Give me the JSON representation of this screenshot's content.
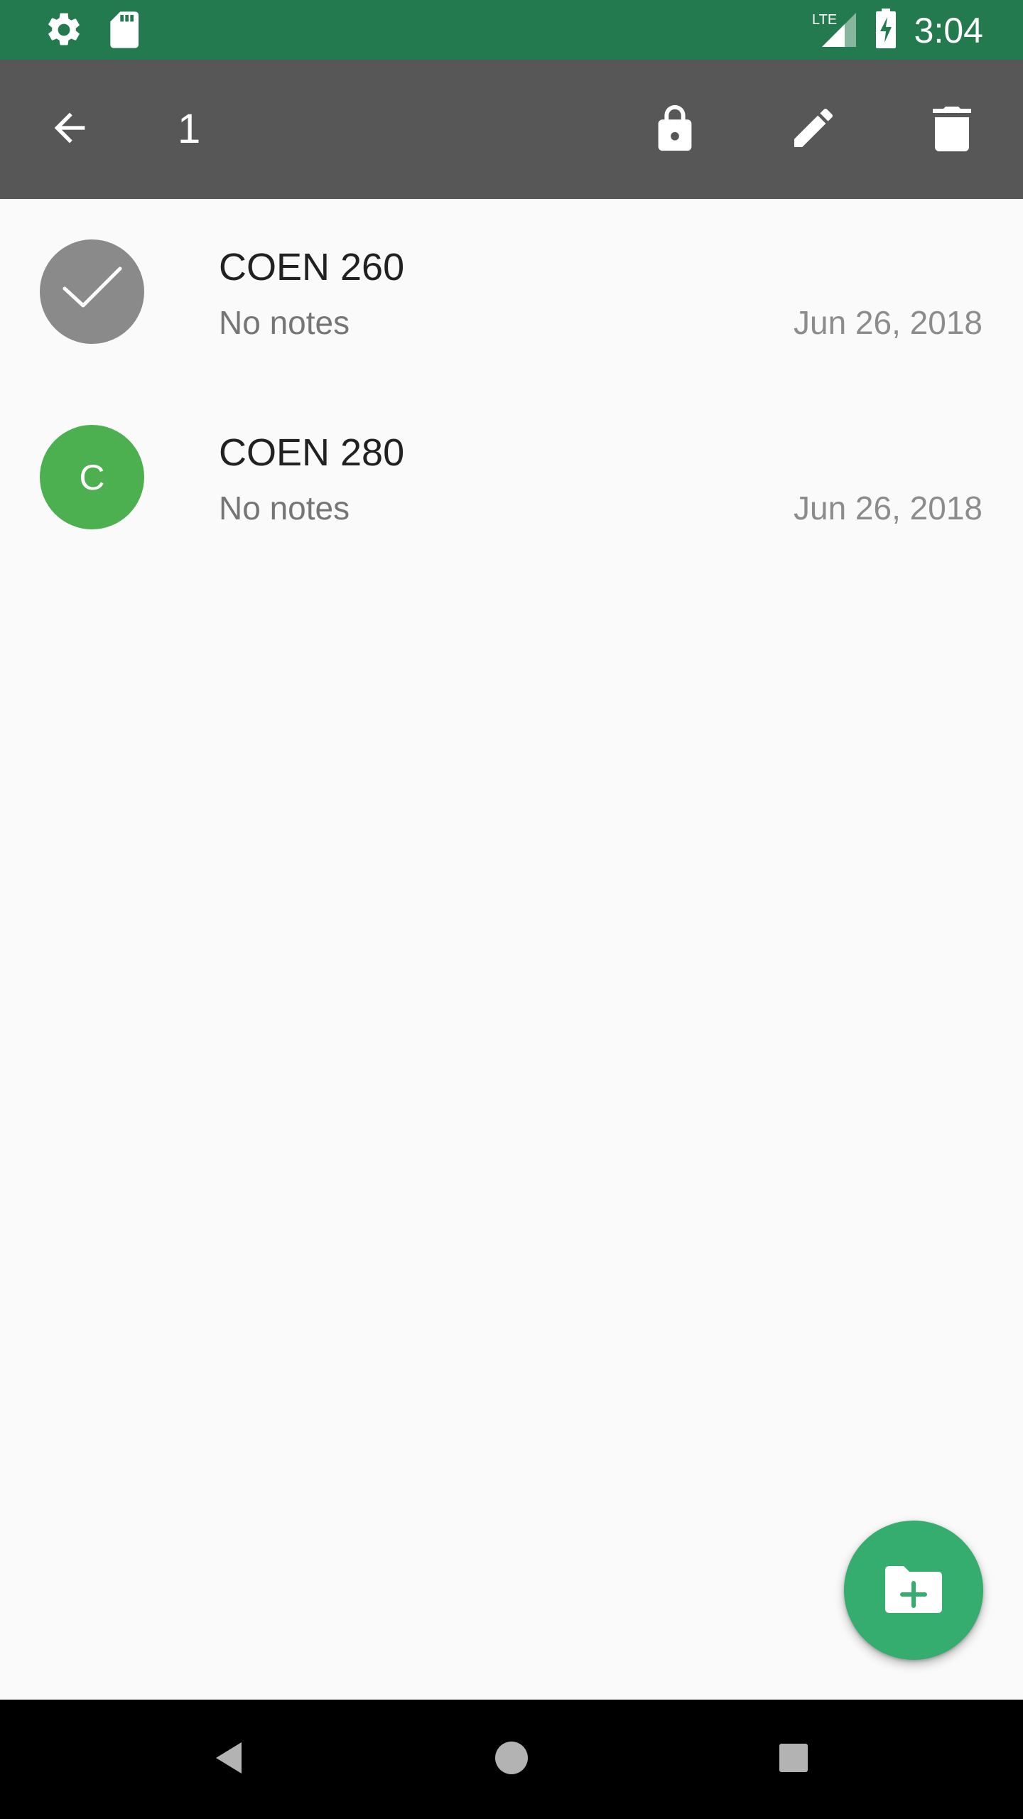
{
  "status_bar": {
    "time": "3:04",
    "network": "LTE",
    "left_icons": [
      "settings-icon",
      "sd-card-icon"
    ],
    "right_icons": [
      "signal-icon",
      "battery-charging-icon"
    ],
    "color": "#237a4f"
  },
  "action_bar": {
    "selected_count": "1",
    "actions": [
      "back-arrow-icon",
      "lock-icon",
      "edit-pencil-icon",
      "delete-trash-icon"
    ],
    "color": "#575757"
  },
  "notebooks": [
    {
      "title": "COEN 260",
      "notes": "No notes",
      "date": "Jun 26, 2018",
      "avatar_letter": "",
      "selected": true,
      "avatar_color": "#8a8a8a"
    },
    {
      "title": "COEN 280",
      "notes": "No notes",
      "date": "Jun 26, 2018",
      "avatar_letter": "C",
      "selected": false,
      "avatar_color": "#4caf50"
    }
  ],
  "fab": {
    "icon": "add-folder-icon",
    "color": "#34ad6f"
  },
  "nav_bar": {
    "buttons": [
      "nav-back-icon",
      "nav-home-icon",
      "nav-recents-icon"
    ]
  }
}
